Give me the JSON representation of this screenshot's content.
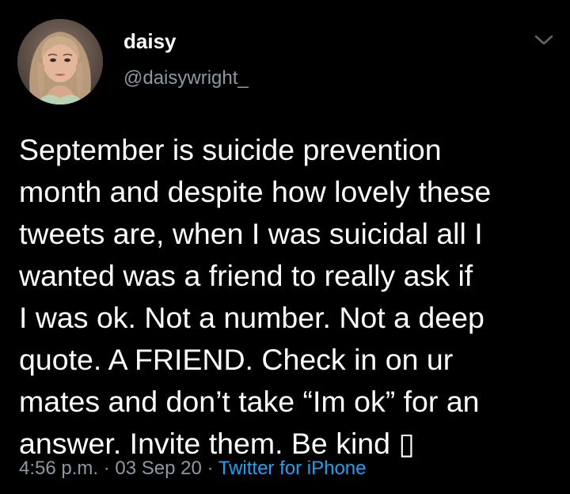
{
  "tweet": {
    "author": {
      "display_name": "daisy",
      "handle": "@daisywright_",
      "avatar": "profile-photo"
    },
    "menu_icon": "chevron-down-icon",
    "text": "September is suicide prevention\nmonth and despite how lovely these\ntweets are, when I was suicidal all I\nwanted was a friend to really ask if\nI was ok. Not a number. Not a deep\nquote. A FRIEND. Check in on ur\nmates and don’t take “Im ok” for an\nanswer. Invite them. Be kind ▯",
    "time": "4:56 p.m.",
    "separator": " · ",
    "date": "03 Sep 20",
    "source": "Twitter for iPhone"
  },
  "colors": {
    "background": "#000000",
    "primary_text": "#ffffff",
    "secondary_text": "#8b98a5",
    "link": "#1da1f2"
  }
}
